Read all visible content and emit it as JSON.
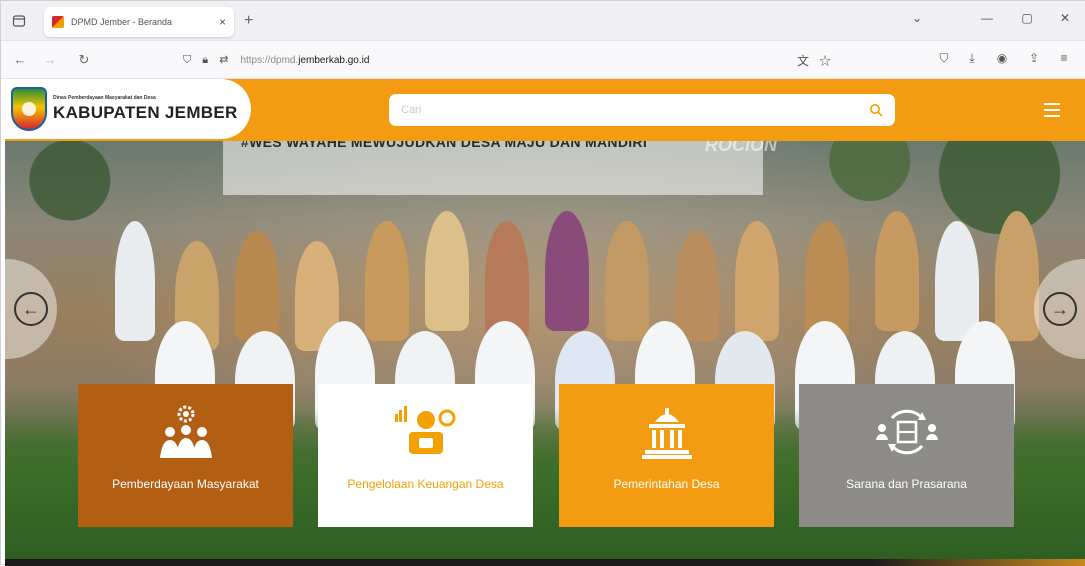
{
  "browser": {
    "tab_title": "DPMD Jember - Beranda",
    "tab_close": "×",
    "new_tab": "+",
    "url_prefix": "https://dpmd.",
    "url_domain": "jemberkab.go.id",
    "window_controls": [
      "⌄",
      "—",
      "▢",
      "✕"
    ]
  },
  "header": {
    "org_subtitle": "Dinas Pemberdayaan Masyarakat dan Desa",
    "org_title": "KABUPATEN JEMBER",
    "search_placeholder": "Cari"
  },
  "hero": {
    "caption": "#WES WAYAHE MEWUJUDKAN DESA MAJU DAN MANDIRI",
    "caption_extra": "ROCION",
    "prev_arrow": "←",
    "next_arrow": "→"
  },
  "cards": [
    {
      "label": "Pemberdayaan Masyarakat",
      "icon": "community-gear-icon",
      "color": "#b25e13"
    },
    {
      "label": "Pengelolaan Keuangan Desa",
      "icon": "finance-person-icon",
      "color": "#ffffff"
    },
    {
      "label": "Pemerintahan Desa",
      "icon": "government-building-icon",
      "color": "#f39c12"
    },
    {
      "label": "Sarana dan Prasarana",
      "icon": "infrastructure-cycle-icon",
      "color": "#8d8b87"
    }
  ],
  "colors": {
    "brand_orange": "#f39c12",
    "brand_brown": "#b25e13",
    "neutral_gray": "#8d8b87"
  }
}
